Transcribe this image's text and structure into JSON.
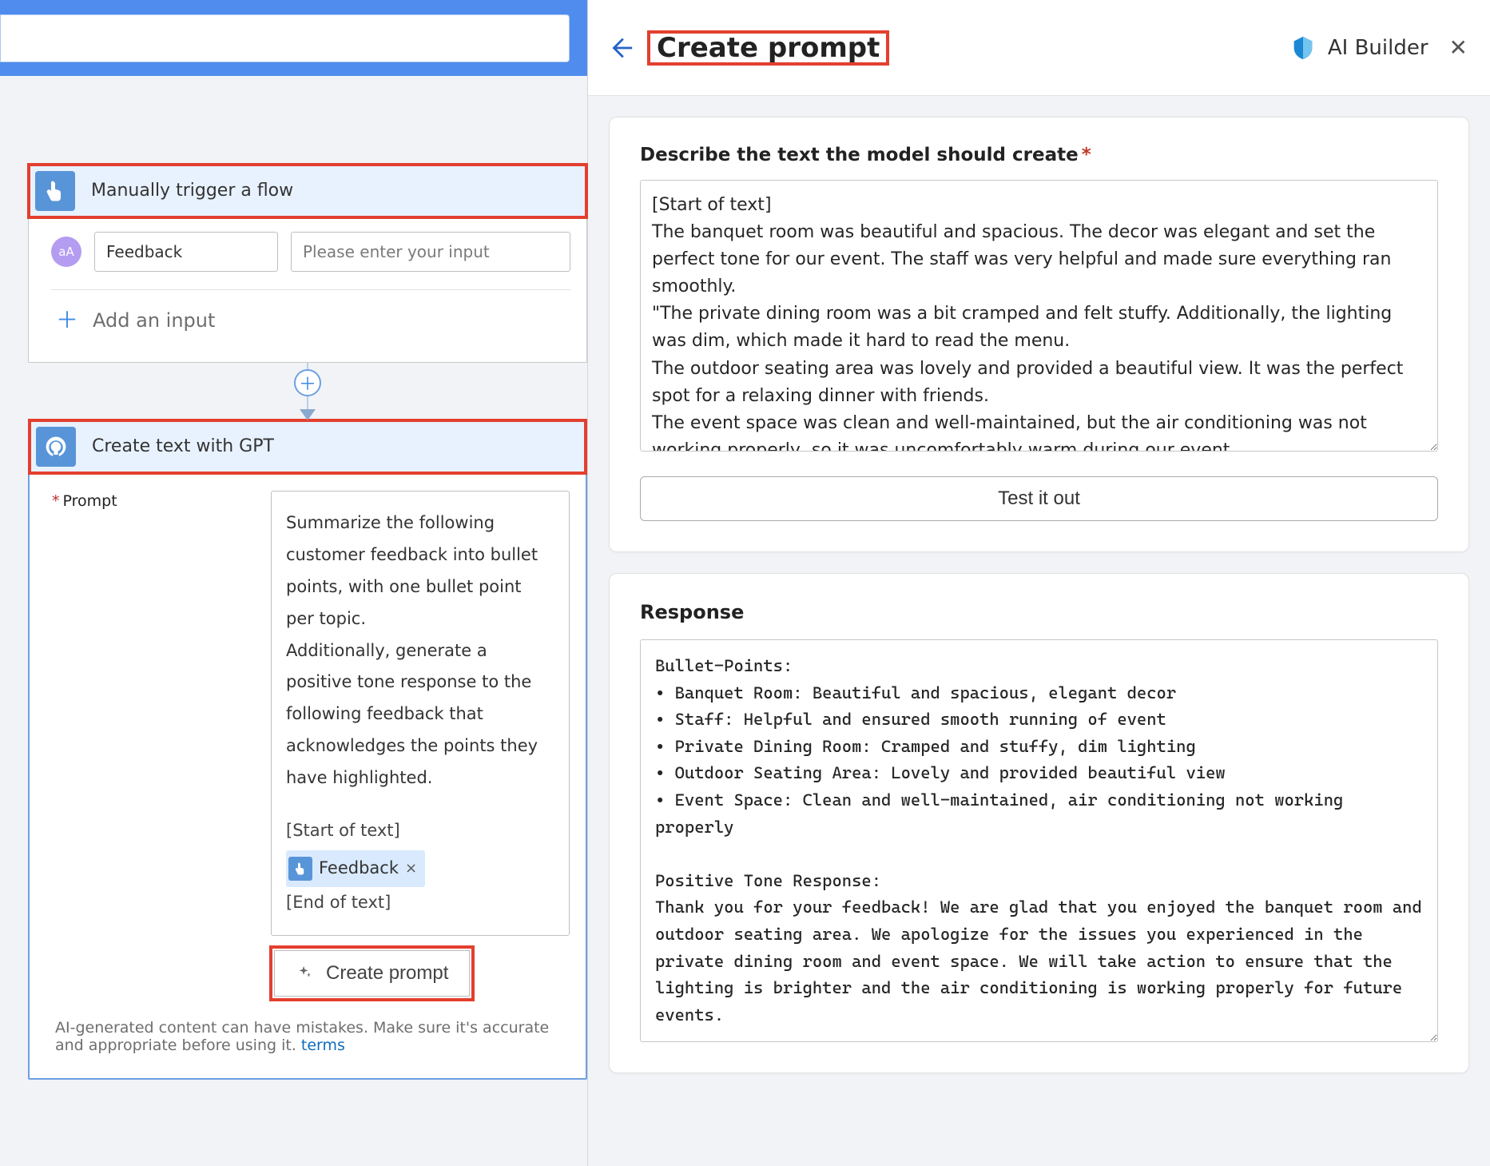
{
  "flow": {
    "trigger": {
      "title": "Manually trigger a flow",
      "param_badge": "aA",
      "param_name": "Feedback",
      "param_placeholder": "Please enter your input",
      "add_input_label": "Add an input"
    },
    "gpt": {
      "title": "Create text with GPT",
      "prompt_label": "Prompt",
      "prompt_text": "Summarize the following customer feedback into bullet points, with one bullet point per topic.\nAdditionally, generate a positive tone response to the following feedback that acknowledges the points they have highlighted.",
      "start_tag": "[Start of text]",
      "token_label": "Feedback",
      "end_tag": "[End of text]",
      "create_prompt_btn": "Create prompt",
      "disclaimer_text": "AI-generated content can have mistakes. Make sure it's accurate and appropriate before using it. ",
      "terms_link": "terms"
    }
  },
  "panel": {
    "title": "Create prompt",
    "brand": "AI Builder",
    "describe_label": "Describe the text the model should create",
    "describe_value": "[Start of text]\nThe banquet room was beautiful and spacious. The decor was elegant and set the perfect tone for our event. The staff was very helpful and made sure everything ran smoothly.\n\"The private dining room was a bit cramped and felt stuffy. Additionally, the lighting was dim, which made it hard to read the menu.\nThe outdoor seating area was lovely and provided a beautiful view. It was the perfect spot for a relaxing dinner with friends.\nThe event space was clean and well-maintained, but the air conditioning was not working properly, so it was uncomfortably warm during our event.",
    "test_btn": "Test it out",
    "response_label": "Response",
    "response_value": "Bullet-Points:\n• Banquet Room: Beautiful and spacious, elegant decor\n• Staff: Helpful and ensured smooth running of event\n• Private Dining Room: Cramped and stuffy, dim lighting\n• Outdoor Seating Area: Lovely and provided beautiful view\n• Event Space: Clean and well-maintained, air conditioning not working properly\n\nPositive Tone Response:\nThank you for your feedback! We are glad that you enjoyed the banquet room and outdoor seating area. We apologize for the issues you experienced in the private dining room and event space. We will take action to ensure that the lighting is brighter and the air conditioning is working properly for future events."
  }
}
